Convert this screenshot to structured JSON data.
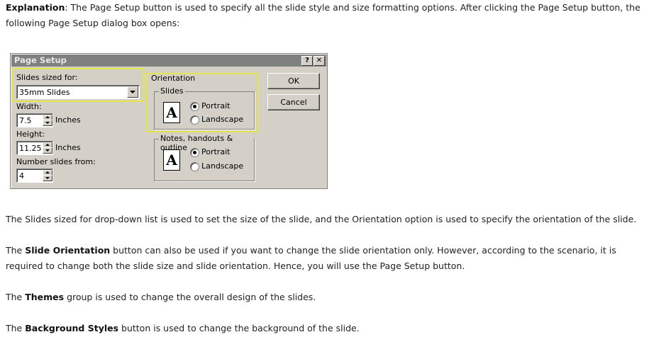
{
  "intro": {
    "label": "Explanation",
    "text": ": The Page Setup button is used to specify all the slide style and size formatting options. After clicking the Page Setup button, the following Page Setup dialog box opens:"
  },
  "dialog": {
    "title": "Page Setup",
    "help_glyph": "?",
    "close_glyph": "✕",
    "slides_sized_for": {
      "label": "Slides sized for:",
      "value": "35mm Slides"
    },
    "width": {
      "label": "Width:",
      "value": "7.5",
      "unit": "Inches"
    },
    "height": {
      "label": "Height:",
      "value": "11.25",
      "unit": "Inches"
    },
    "number_from": {
      "label": "Number slides from:",
      "value": "4"
    },
    "orientation": {
      "caption": "Orientation",
      "slides": {
        "caption": "Slides",
        "portrait": "Portrait",
        "landscape": "Landscape",
        "icon_letter": "A"
      },
      "notes": {
        "caption": "Notes, handouts & outline",
        "portrait": "Portrait",
        "landscape": "Landscape",
        "icon_letter": "A"
      }
    },
    "ok": "OK",
    "cancel": "Cancel"
  },
  "paragraphs": {
    "p1": "The Slides sized for drop-down list is used to set the size of the slide, and the Orientation option is used to specify the orientation of the slide.",
    "p2_before": "The ",
    "p2_bold": "Slide Orientation",
    "p2_after": " button can also be used if you want to change the slide orientation only. However, according to the scenario, it is required to change both the slide size and slide orientation. Hence, you will use the Page Setup button.",
    "p3_before": "The ",
    "p3_bold": "Themes",
    "p3_after": " group is used to change the overall design of the slides.",
    "p4_before": "The ",
    "p4_bold": "Background Styles",
    "p4_after": " button is used to change the background of the slide."
  },
  "colors": {
    "highlight": "#e2e64a",
    "dialog_bg": "#d4d0c8",
    "titlebar": "#808080"
  }
}
